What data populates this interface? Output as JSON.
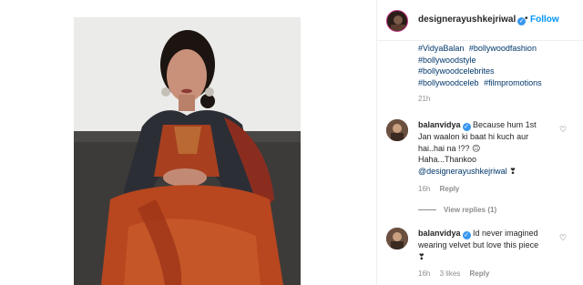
{
  "post": {
    "username": "designerayushkejriwal",
    "follow_label": "Follow",
    "separator": "•",
    "hashtags": [
      "#VidyaBalan",
      "#bollywoodfashion",
      "#bollywoodstyle",
      "#bollywoodcelebrites",
      "#bollywoodceleb",
      "#filmpromotions"
    ],
    "time": "21h"
  },
  "comments": [
    {
      "username": "balanvidya",
      "text_line1": "Because hum 1st",
      "text_line2": "Jan waalon ki baat hi kuch aur",
      "text_line3": "hai..hai na !?? 🙃",
      "text_line4": "Haha...Thankoo",
      "mention": "@designerayushkejriwal",
      "emoji": "❣",
      "time": "16h",
      "reply_label": "Reply",
      "view_replies": "View replies (1)"
    },
    {
      "username": "balanvidya",
      "text_line1": "Id never imagined",
      "text_line2": "wearing velvet but love this piece",
      "emoji": "❣",
      "time": "16h",
      "likes": "3 likes",
      "reply_label": "Reply"
    }
  ],
  "colors": {
    "link": "#00376b",
    "follow": "#0095f6",
    "verified": "#3897f0",
    "meta": "#8e8e8e"
  },
  "icons": {
    "verified": "verified-badge-icon",
    "like": "heart-icon"
  }
}
